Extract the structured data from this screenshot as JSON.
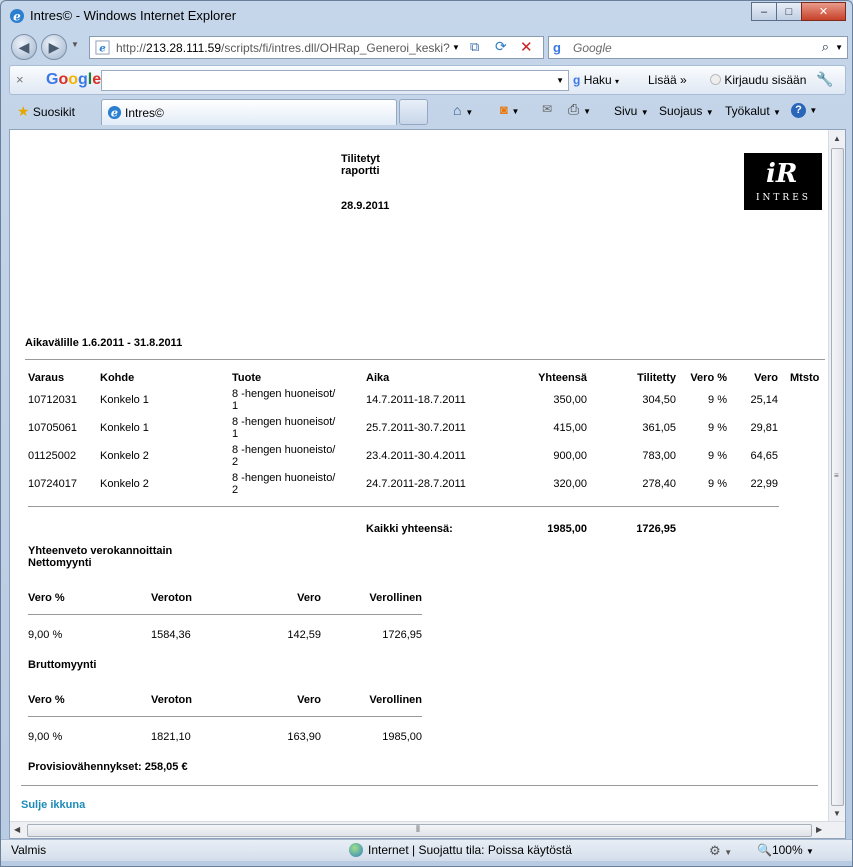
{
  "window": {
    "title": "Intres© - Windows Internet Explorer",
    "min": "–",
    "max": "□",
    "close": "✕"
  },
  "address": {
    "url_prefix": "http://",
    "url_host": "213.28.111.59",
    "url_path": "/scripts/fi/intres.dll/OHRap_Generoi_keski?",
    "search_placeholder": "Google"
  },
  "google_toolbar": {
    "close": "×",
    "logo": "Google",
    "search_button": "Haku",
    "more": "Lisää »",
    "signin": "Kirjaudu sisään"
  },
  "favorites": {
    "label": "Suosikit",
    "tab_title": "Intres©",
    "commands": {
      "page": "Sivu",
      "safety": "Suojaus",
      "tools": "Työkalut"
    }
  },
  "report": {
    "title_line1": "Tilitetyt",
    "title_line2": "raportti",
    "date": "28.9.2011",
    "logo_letter": "iR",
    "logo_text": "INTRES",
    "period": "Aikavälille 1.6.2011 - 31.8.2011",
    "columns": [
      "Varaus",
      "Kohde",
      "Tuote",
      "Aika",
      "Yhteensä",
      "Tilitetty",
      "Vero %",
      "Vero",
      "Mtsto"
    ],
    "rows": [
      {
        "varaus": "10712031",
        "kohde": "Konkelo 1",
        "tuote1": "8 -hengen huoneisot/",
        "tuote2": "1",
        "aika": "14.7.2011-18.7.2011",
        "yhteensa": "350,00",
        "tilitetty": "304,50",
        "veropct": "9 %",
        "vero": "25,14"
      },
      {
        "varaus": "10705061",
        "kohde": "Konkelo 1",
        "tuote1": "8 -hengen huoneisot/",
        "tuote2": "1",
        "aika": "25.7.2011-30.7.2011",
        "yhteensa": "415,00",
        "tilitetty": "361,05",
        "veropct": "9 %",
        "vero": "29,81"
      },
      {
        "varaus": "01125002",
        "kohde": "Konkelo 2",
        "tuote1": "8 -hengen huoneisto/",
        "tuote2": "2",
        "aika": "23.4.2011-30.4.2011",
        "yhteensa": "900,00",
        "tilitetty": "783,00",
        "veropct": "9 %",
        "vero": "64,65"
      },
      {
        "varaus": "10724017",
        "kohde": "Konkelo 2",
        "tuote1": "8 -hengen huoneisto/",
        "tuote2": "2",
        "aika": "24.7.2011-28.7.2011",
        "yhteensa": "320,00",
        "tilitetty": "278,40",
        "veropct": "9 %",
        "vero": "22,99"
      }
    ],
    "total_label": "Kaikki yhteensä:",
    "total_yhteensa": "1985,00",
    "total_tilitetty": "1726,95",
    "summary_title": "Yhteenveto verokannoittain",
    "net_title": "Nettomyynti",
    "sum_columns": [
      "Vero %",
      "Veroton",
      "Vero",
      "Verollinen"
    ],
    "net_row": {
      "pct": "9,00 %",
      "veroton": "1584,36",
      "vero": "142,59",
      "verollinen": "1726,95"
    },
    "gross_title": "Bruttomyynti",
    "gross_row": {
      "pct": "9,00 %",
      "veroton": "1821,10",
      "vero": "163,90",
      "verollinen": "1985,00"
    },
    "provision": "Provisiovähennykset: 258,05 €",
    "close_link": "Sulje ikkuna"
  },
  "status": {
    "left": "Valmis",
    "zone": "Internet | Suojattu tila: Poissa käytöstä",
    "zoom": "100%"
  },
  "colors": {
    "link": "#1c8bb8",
    "logo_bg": "#000000"
  }
}
